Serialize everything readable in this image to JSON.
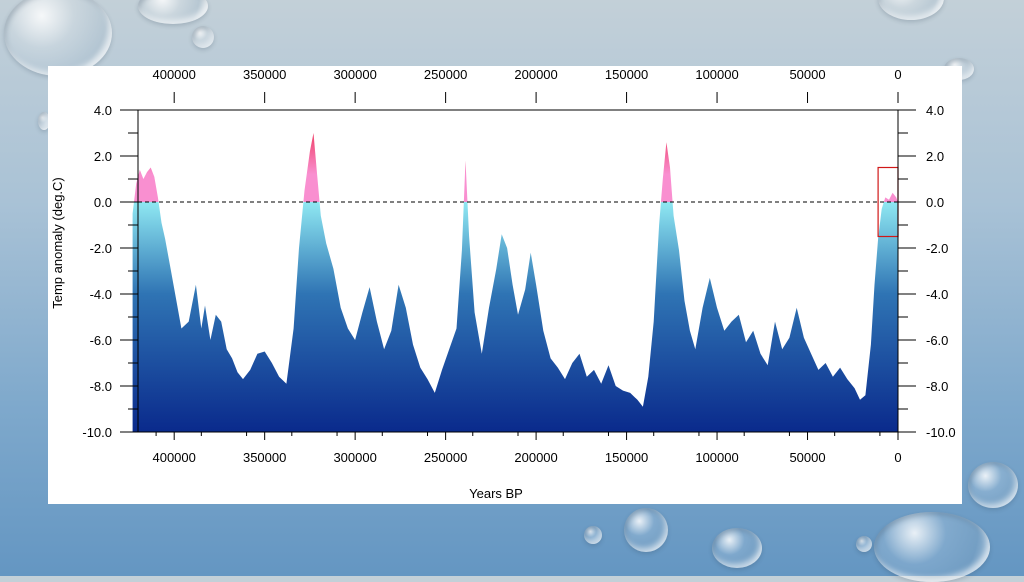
{
  "chart_data": {
    "type": "area",
    "xlabel": "Years BP",
    "ylabel": "Temp anomaly (deg.C)",
    "xlim": [
      420000,
      0
    ],
    "ylim": [
      -10.0,
      4.0
    ],
    "x_ticks": [
      400000,
      350000,
      300000,
      250000,
      200000,
      150000,
      100000,
      50000,
      0
    ],
    "y_ticks": [
      "4.0",
      "2.0",
      "0.0",
      "-2.0",
      "-4.0",
      "-6.0",
      "-8.0",
      "-10.0"
    ],
    "reference_line": {
      "y": 0.0,
      "style": "dashed"
    },
    "highlight_box": {
      "x_range": [
        11000,
        0
      ],
      "y_range": [
        -1.5,
        1.5
      ]
    },
    "colors": {
      "warm": "#ee3a5f",
      "warm_light": "#f98fd0",
      "cool_light": "#8fe8f2",
      "cool_mid": "#2f74b4",
      "cool_dark": "#0a2a8c"
    },
    "series": [
      {
        "x": [
          423000,
          421000,
          419000,
          417000,
          415000,
          413000,
          411000,
          409000,
          407000,
          405000,
          402000,
          399000,
          396000,
          392000,
          388000,
          385000,
          383000,
          380000,
          377000,
          374000,
          371000,
          368000,
          365000,
          362000,
          358000,
          354000,
          350000,
          346000,
          342000,
          338000,
          334000,
          331000,
          328000,
          325000,
          323000,
          321000,
          319000,
          316000,
          312000,
          308000,
          304000,
          300000,
          296000,
          292000,
          288000,
          284000,
          280000,
          276000,
          272000,
          268000,
          264000,
          260000,
          256000,
          252000,
          248000,
          244000,
          241000,
          239000,
          237000,
          234000,
          230000,
          226000,
          222000,
          219000,
          216000,
          213000,
          210000,
          206000,
          203000,
          200000,
          196000,
          192000,
          188000,
          184000,
          180000,
          176000,
          172000,
          168000,
          164000,
          160000,
          156000,
          152000,
          148000,
          144000,
          141000,
          138000,
          135000,
          132000,
          130000,
          128000,
          126000,
          124000,
          121000,
          118000,
          115000,
          112000,
          108000,
          104000,
          100000,
          96000,
          92000,
          88000,
          84000,
          80000,
          76000,
          72000,
          68000,
          64000,
          60000,
          56000,
          52000,
          48000,
          44000,
          40000,
          36000,
          32000,
          28000,
          24000,
          21000,
          18000,
          15000,
          13000,
          11000,
          9000,
          7000,
          5000,
          3000,
          1000,
          0
        ],
        "y": [
          -0.5,
          0.8,
          1.4,
          1.0,
          1.3,
          1.5,
          1.1,
          0.2,
          -0.9,
          -1.6,
          -2.9,
          -4.2,
          -5.5,
          -5.2,
          -3.6,
          -5.5,
          -4.5,
          -6.0,
          -4.9,
          -5.2,
          -6.4,
          -6.8,
          -7.4,
          -7.7,
          -7.3,
          -6.6,
          -6.5,
          -7.0,
          -7.6,
          -7.9,
          -5.5,
          -2.0,
          0.5,
          2.2,
          3.0,
          1.2,
          -0.6,
          -1.8,
          -2.9,
          -4.6,
          -5.5,
          -6.0,
          -4.8,
          -3.7,
          -5.2,
          -6.4,
          -5.6,
          -3.6,
          -4.6,
          -6.2,
          -7.2,
          -7.7,
          -8.3,
          -7.3,
          -6.4,
          -5.5,
          -2.1,
          1.8,
          -1.5,
          -4.8,
          -6.6,
          -4.6,
          -2.9,
          -1.4,
          -2.0,
          -3.6,
          -4.9,
          -3.8,
          -2.2,
          -3.6,
          -5.6,
          -6.8,
          -7.2,
          -7.7,
          -7.0,
          -6.6,
          -7.6,
          -7.3,
          -7.9,
          -7.1,
          -8.0,
          -8.2,
          -8.3,
          -8.6,
          -8.9,
          -7.6,
          -5.2,
          -1.0,
          1.0,
          2.6,
          1.5,
          -0.6,
          -2.1,
          -4.3,
          -5.6,
          -6.4,
          -4.6,
          -3.3,
          -4.6,
          -5.6,
          -5.2,
          -4.9,
          -6.1,
          -5.6,
          -6.6,
          -7.1,
          -5.2,
          -6.4,
          -5.9,
          -4.6,
          -5.9,
          -6.6,
          -7.3,
          -7.0,
          -7.6,
          -7.2,
          -7.7,
          -8.1,
          -8.6,
          -8.4,
          -6.2,
          -3.6,
          -1.6,
          -0.3,
          0.2,
          0.1,
          0.4,
          0.2,
          0.0
        ]
      }
    ]
  }
}
